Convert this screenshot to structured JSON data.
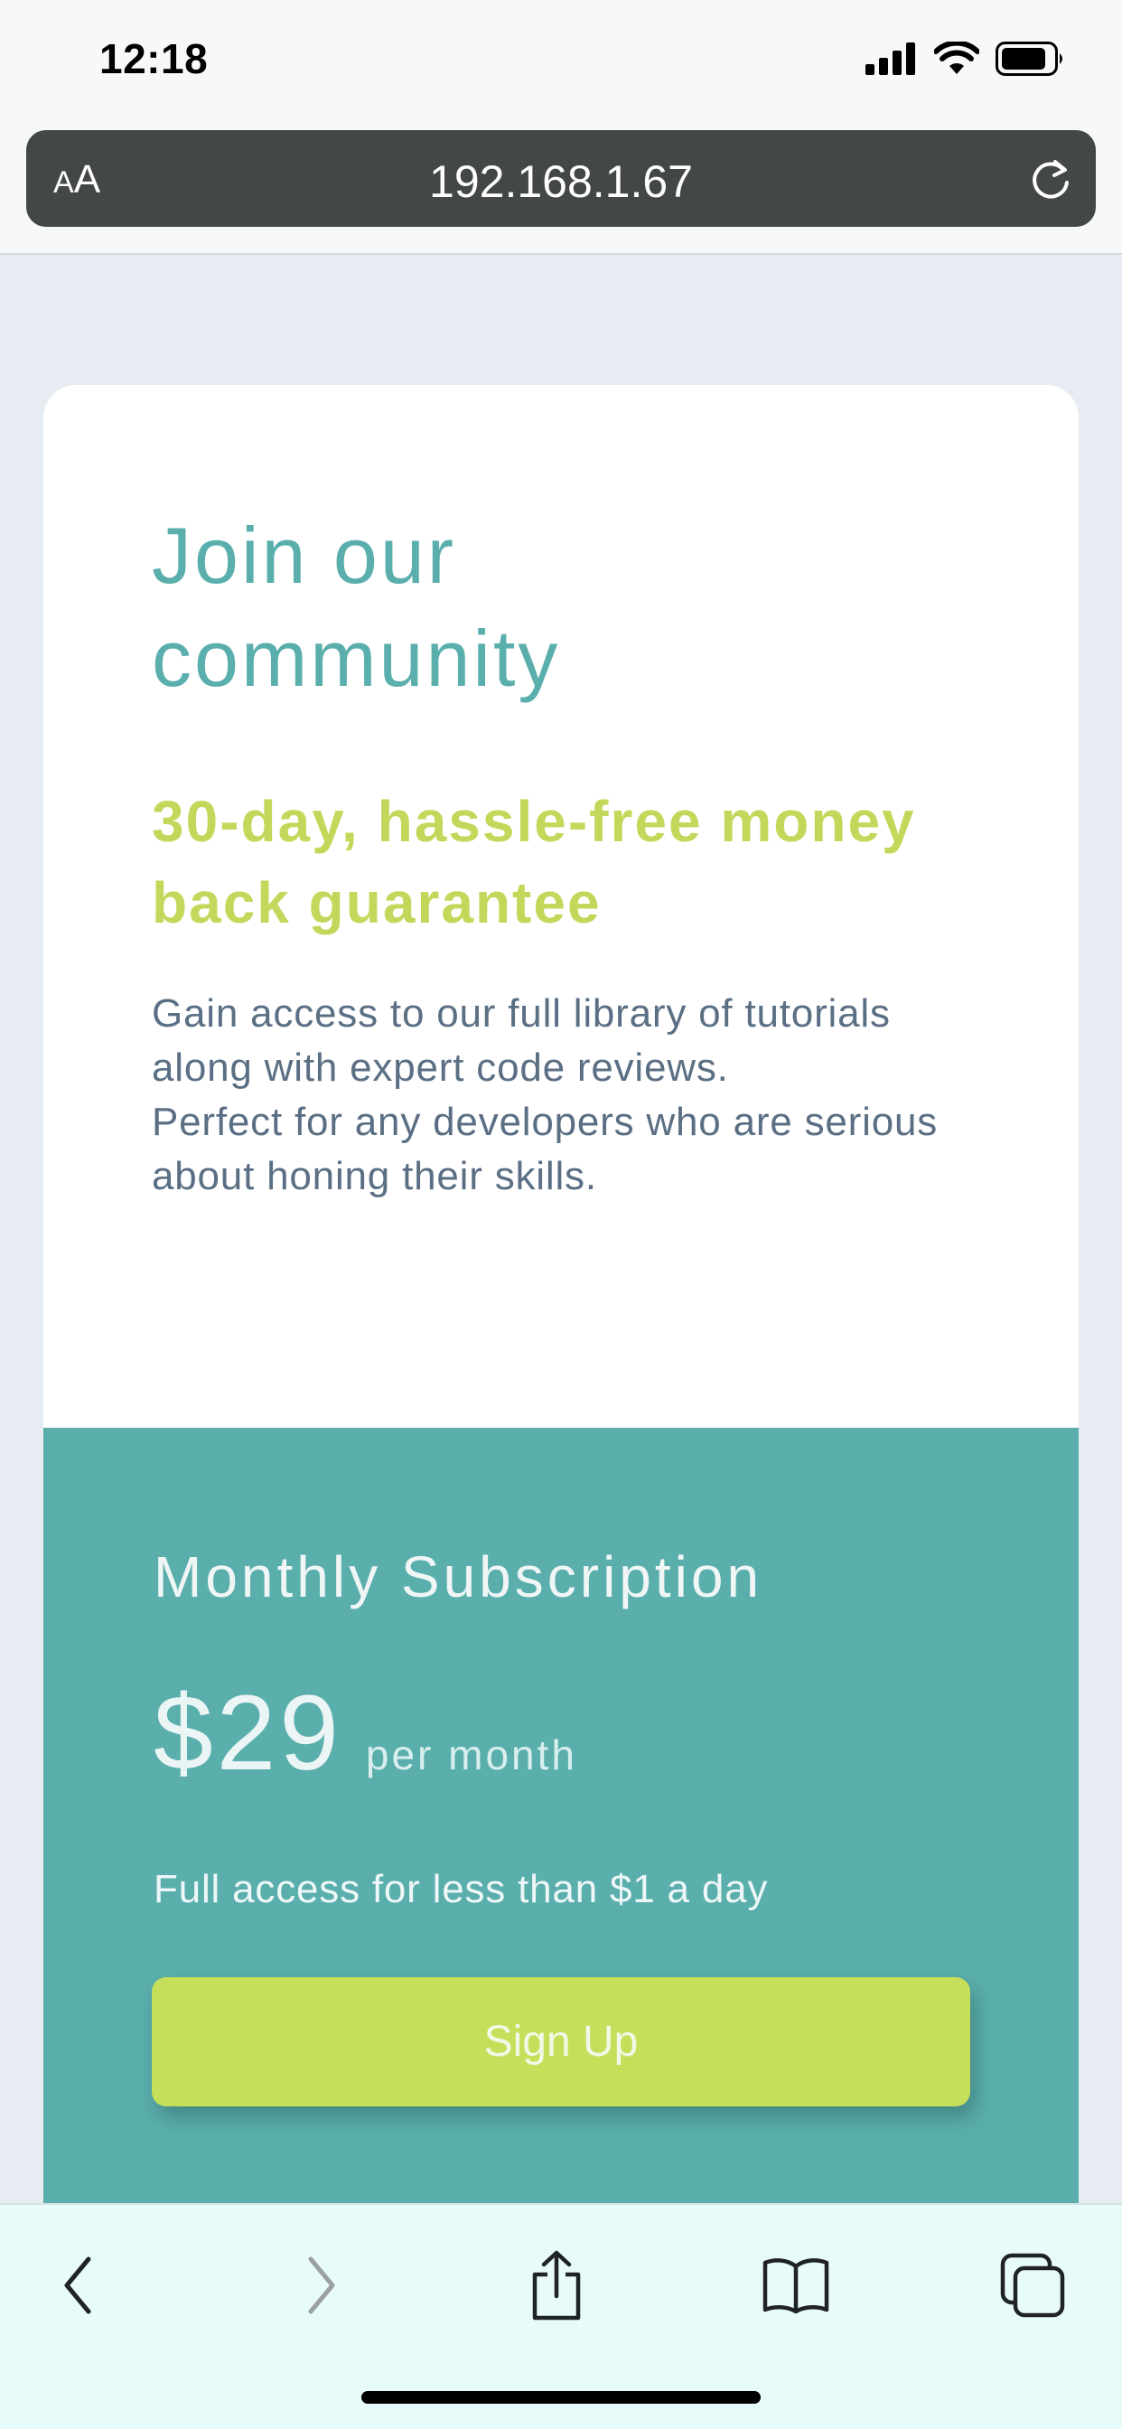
{
  "status_bar": {
    "time": "12:18",
    "icons": [
      "cellular-signal-icon",
      "wifi-icon",
      "battery-icon"
    ]
  },
  "browser": {
    "text_size_label_small": "A",
    "text_size_label_large": "A",
    "url": "192.168.1.67",
    "reload_icon": "reload-icon"
  },
  "card": {
    "title": "Join our community",
    "subtitle": "30-day, hassle-free money back guarantee",
    "description_line1": "Gain access to our full library of tutorials along with expert code reviews.",
    "description_line2": "Perfect for any developers who are serious about honing their skills."
  },
  "subscription": {
    "heading": "Monthly Subscription",
    "price": "$29",
    "price_unit": "per month",
    "access_text": "Full access for less than $1 a day",
    "signup_label": "Sign Up"
  },
  "toolbar": {
    "icons": [
      "back-icon",
      "forward-icon",
      "share-icon",
      "bookmarks-icon",
      "tabs-icon"
    ]
  },
  "colors": {
    "accent_teal": "#5aafad",
    "accent_lime": "#c5d75a",
    "text_slate": "#5b6f84",
    "page_background": "#e6ecf1"
  }
}
